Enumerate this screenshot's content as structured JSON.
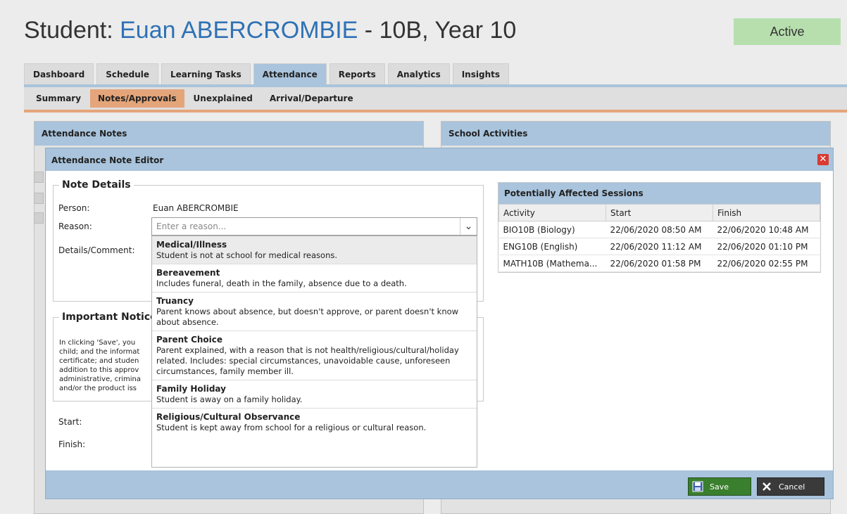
{
  "header": {
    "title_prefix": "Student: ",
    "student_name": "Euan ABERCROMBIE",
    "title_suffix": " - 10B, Year 10",
    "status": "Active"
  },
  "main_tabs": [
    "Dashboard",
    "Schedule",
    "Learning Tasks",
    "Attendance",
    "Reports",
    "Analytics",
    "Insights"
  ],
  "sub_tabs": [
    "Summary",
    "Notes/Approvals",
    "Unexplained",
    "Arrival/Departure"
  ],
  "panels": {
    "left_title": "Attendance Notes",
    "right_title": "School Activities"
  },
  "modal": {
    "title": "Attendance Note Editor",
    "note_details": {
      "legend": "Note Details",
      "person_label": "Person:",
      "person_value": "Euan ABERCROMBIE",
      "reason_label": "Reason:",
      "reason_placeholder": "Enter a reason...",
      "details_label": "Details/Comment:"
    },
    "notice": {
      "legend": "Important Notice",
      "lines": [
        "In clicking 'Save', you",
        "child; and the informat",
        "certificate; and studen",
        "addition to this approv",
        "administrative, crimina",
        "and/or the product iss"
      ]
    },
    "start_label": "Start:",
    "finish_label": "Finish:",
    "reason_options": [
      {
        "title": "Medical/Illness",
        "desc": "Student is not at school for medical reasons."
      },
      {
        "title": "Bereavement",
        "desc": "Includes funeral, death in the family, absence due to a death."
      },
      {
        "title": "Truancy",
        "desc": "Parent knows about absence, but doesn't approve, or parent doesn't know about absence."
      },
      {
        "title": "Parent Choice",
        "desc": "Parent explained, with a reason that is not health/religious/cultural/holiday related. Includes: special circumstances, unavoidable cause, unforeseen circumstances, family member ill."
      },
      {
        "title": "Family Holiday",
        "desc": "Student is away on a family holiday."
      },
      {
        "title": "Religious/Cultural Observance",
        "desc": "Student is kept away from school for a religious or cultural reason."
      }
    ],
    "sessions": {
      "title": "Potentially Affected Sessions",
      "columns": [
        "Activity",
        "Start",
        "Finish"
      ],
      "rows": [
        [
          "BIO10B (Biology)",
          "22/06/2020 08:50 AM",
          "22/06/2020 10:48 AM"
        ],
        [
          "ENG10B (English)",
          "22/06/2020 11:12 AM",
          "22/06/2020 01:10 PM"
        ],
        [
          "MATH10B (Mathema...",
          "22/06/2020 01:58 PM",
          "22/06/2020 02:55 PM"
        ]
      ]
    },
    "save_label": "Save",
    "cancel_label": "Cancel"
  },
  "colors": {
    "accent_blue": "#a9c4dc",
    "accent_orange": "#e4a57a",
    "name_blue": "#2f72b5",
    "status_green": "#b7dfae",
    "save_green": "#3a7f2d",
    "close_red": "#d93a32"
  }
}
